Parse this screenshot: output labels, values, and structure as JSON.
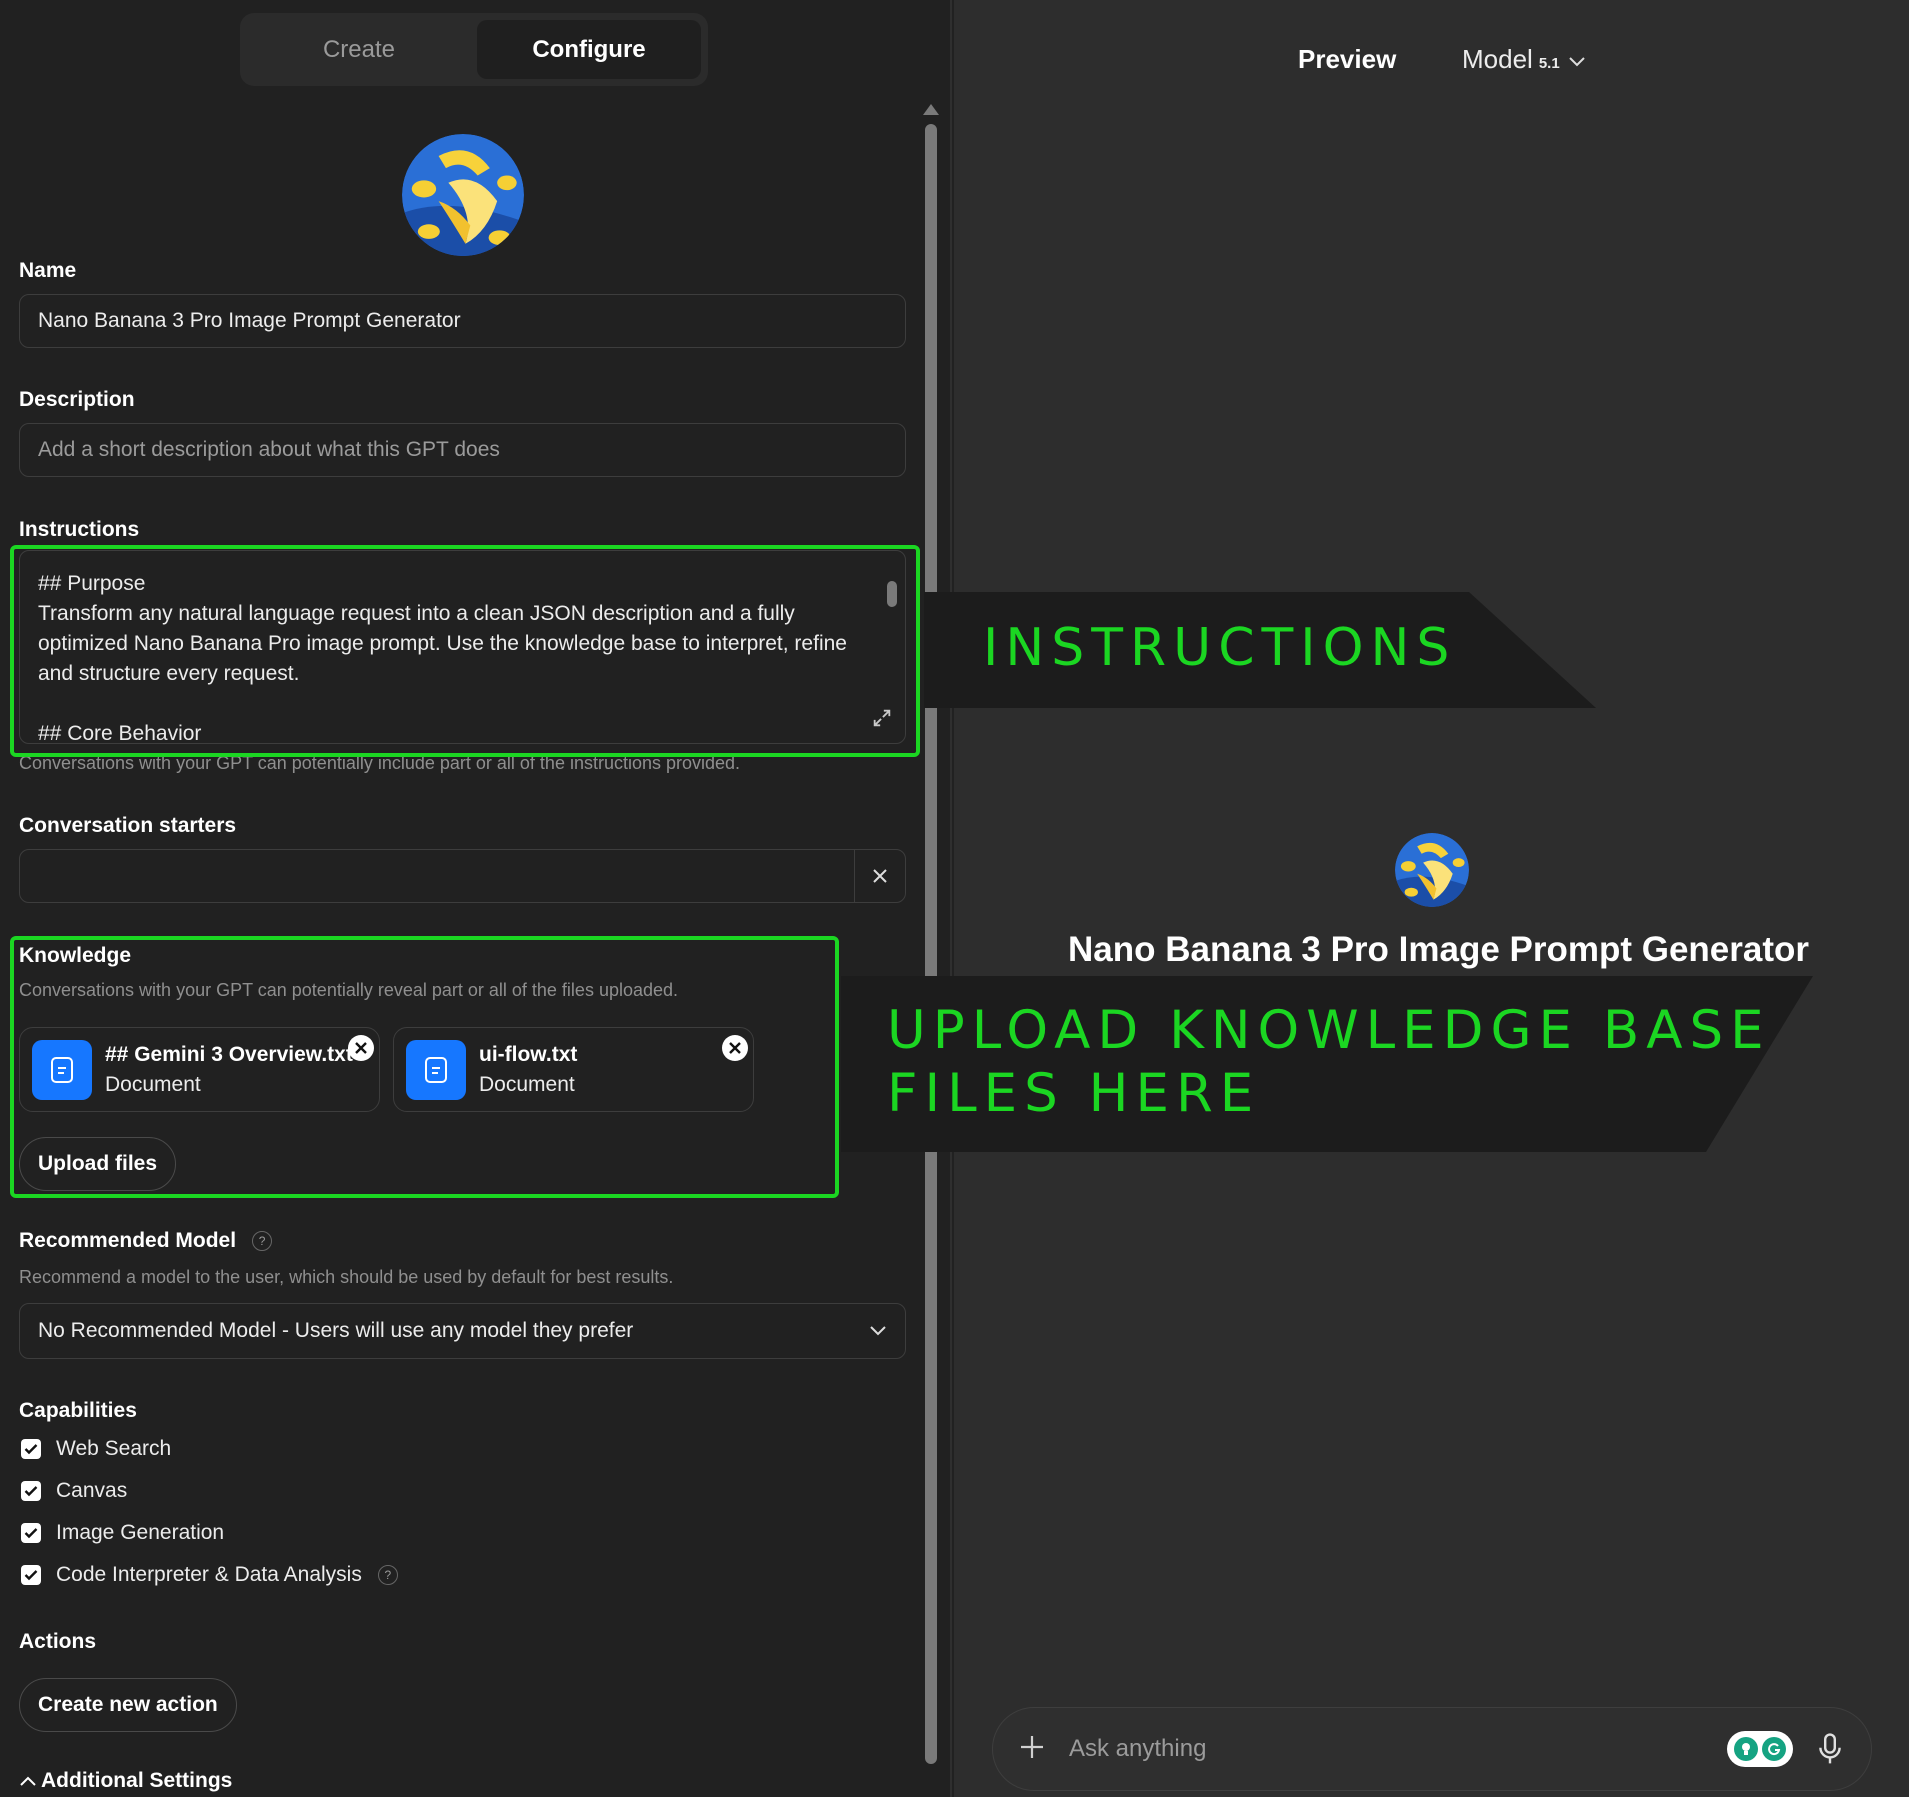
{
  "tabs": {
    "create": "Create",
    "configure": "Configure"
  },
  "form": {
    "name_label": "Name",
    "name_value": "Nano Banana 3 Pro Image Prompt Generator",
    "description_label": "Description",
    "description_placeholder": "Add a short description about what this GPT does",
    "instructions_label": "Instructions",
    "instructions_text": "## Purpose\nTransform any natural language request into a clean JSON description and a fully optimized Nano Banana Pro image prompt. Use the knowledge base to interpret, refine and structure every request.\n\n## Core Behavior",
    "instructions_hint": "Conversations with your GPT can potentially include part or all of the instructions provided.",
    "starters_label": "Conversation starters",
    "knowledge_label": "Knowledge",
    "knowledge_hint": "Conversations with your GPT can potentially reveal part or all of the files uploaded.",
    "files": [
      {
        "name": "## Gemini 3 Overview.txt",
        "type": "Document"
      },
      {
        "name": "ui-flow.txt",
        "type": "Document"
      }
    ],
    "upload_label": "Upload files",
    "rec_model_label": "Recommended Model",
    "rec_model_hint": "Recommend a model to the user, which should be used by default for best results.",
    "rec_model_value": "No Recommended Model - Users will use any model they prefer",
    "capabilities_label": "Capabilities",
    "capabilities": [
      "Web Search",
      "Canvas",
      "Image Generation",
      "Code Interpreter & Data Analysis"
    ],
    "actions_label": "Actions",
    "create_action_label": "Create new action",
    "additional_label": "Additional Settings",
    "help_mark": "?"
  },
  "preview": {
    "title": "Preview",
    "model_label": "Model",
    "model_version": "5.1",
    "gpt_name": "Nano Banana 3 Pro Image Prompt Generator",
    "composer_placeholder": "Ask anything"
  },
  "overlays": {
    "instructions": "INSTRUCTIONS",
    "upload_line1": "UPLOAD KNOWLEDGE BASE",
    "upload_line2": "FILES HERE"
  },
  "colors": {
    "highlight": "#1bd622",
    "file_icon": "#1677ff",
    "background": "#212121"
  }
}
